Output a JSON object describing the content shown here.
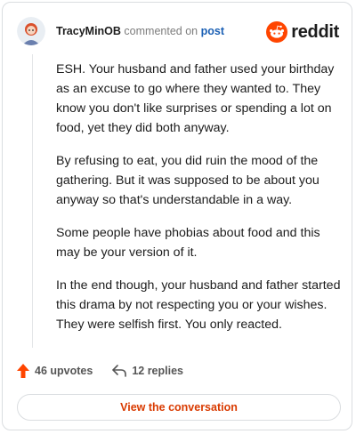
{
  "header": {
    "username": "TracyMinOB",
    "action_text": "commented on",
    "post_link": "post",
    "brand": "reddit"
  },
  "comment": {
    "paragraphs": [
      "ESH. Your husband and father used your birthday as an excuse to go where they wanted to. They know you don't like surprises or spending a lot on food, yet they did both anyway.",
      "By refusing to eat, you did ruin the mood of the gathering. But it was supposed to be about you anyway so that's understandable in a way.",
      "Some people have phobias about food and this may be your version of it.",
      "In the end though, your husband and father started this drama by not respecting you or your wishes. They were selfish first. You only reacted."
    ]
  },
  "actions": {
    "upvotes": "46 upvotes",
    "replies": "12 replies"
  },
  "footer": {
    "view_button": "View the conversation"
  },
  "colors": {
    "brand_orange": "#ff4500",
    "link_blue": "#1a5fb4",
    "cta_orange": "#d93a00"
  },
  "icons": [
    "avatar",
    "reddit-logo-icon",
    "upvote-arrow-icon",
    "reply-arrow-icon"
  ]
}
